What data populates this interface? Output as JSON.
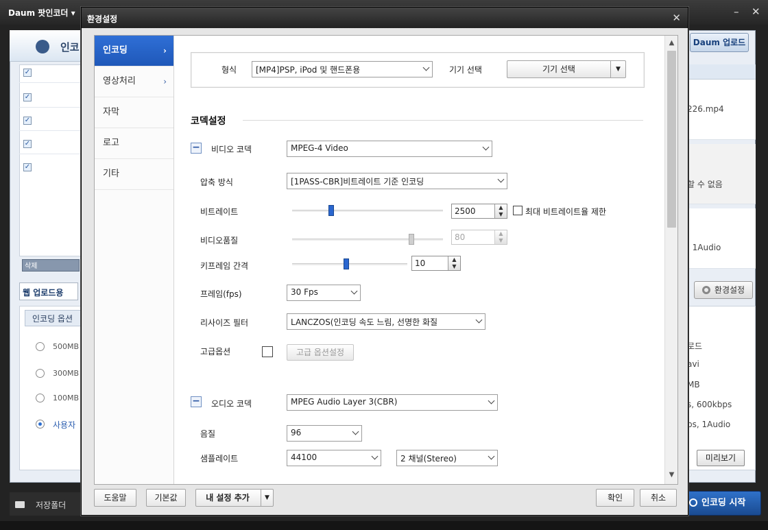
{
  "background": {
    "app_title": "Daum 팟인코더 ▾",
    "win_minimize": "–",
    "win_close": "✕",
    "logo_text": "인코",
    "upload_button": "Daum 업로드",
    "delete_button": "삭제",
    "web_upload_label": "웹 업로드용",
    "encoding_option_header": "인코딩 옵션",
    "size_options": [
      "500MB",
      "300MB",
      "100MB",
      "사용자"
    ],
    "right_texts": {
      "file_name": "226.mp4",
      "cannot": "할 수 없음",
      "audio1": ", 1Audio",
      "upload": "로드",
      "ext": "avi",
      "mb": "MB",
      "bitrate": "s, 600kbps",
      "audio2": "ps, 1Audio"
    },
    "settings_button": "환경설정",
    "preview_button": "미리보기",
    "save_folder": "저장폴더",
    "start_button": "인코딩 시작"
  },
  "dialog": {
    "title": "환경설정",
    "close": "✕",
    "nav": [
      {
        "label": "인코딩",
        "arrow": "›"
      },
      {
        "label": "영상처리",
        "arrow": "›"
      },
      {
        "label": "자막",
        "arrow": ""
      },
      {
        "label": "로고",
        "arrow": ""
      },
      {
        "label": "기타",
        "arrow": ""
      }
    ],
    "format": {
      "label": "형식",
      "value": "[MP4]PSP, iPod 및 핸드폰용",
      "device_label": "기기 선택",
      "device_button": "기기 선택"
    },
    "codec_section_title": "코덱설정",
    "video": {
      "label": "비디오 코덱",
      "codec": "MPEG-4 Video",
      "compression_label": "압축 방식",
      "compression": "[1PASS-CBR]비트레이트 기준 인코딩",
      "bitrate_label": "비트레이트",
      "bitrate": "2500",
      "bitrate_level": 0.25,
      "max_bitrate_label": "최대 비트레이트율 제한",
      "quality_label": "비디오품질",
      "quality": "80",
      "quality_level": 0.8,
      "keyframe_label": "키프레임 간격",
      "keyframe": "10",
      "keyframe_level": 0.47,
      "fps_label": "프레임(fps)",
      "fps": "30 Fps",
      "resize_label": "리사이즈 필터",
      "resize": "LANCZOS(인코딩 속도 느림, 선명한 화질",
      "advanced_label": "고급옵션",
      "advanced_button": "고급 옵션설정"
    },
    "audio": {
      "label": "오디오 코덱",
      "codec": "MPEG Audio Layer 3(CBR)",
      "quality_label": "음질",
      "quality": "96",
      "samplerate_label": "샘플레이트",
      "samplerate": "44100",
      "channels": "2 채널(Stereo)"
    },
    "footer": {
      "help": "도움말",
      "default": "기본값",
      "add_setting": "내 설정 추가",
      "ok": "확인",
      "cancel": "취소"
    }
  }
}
